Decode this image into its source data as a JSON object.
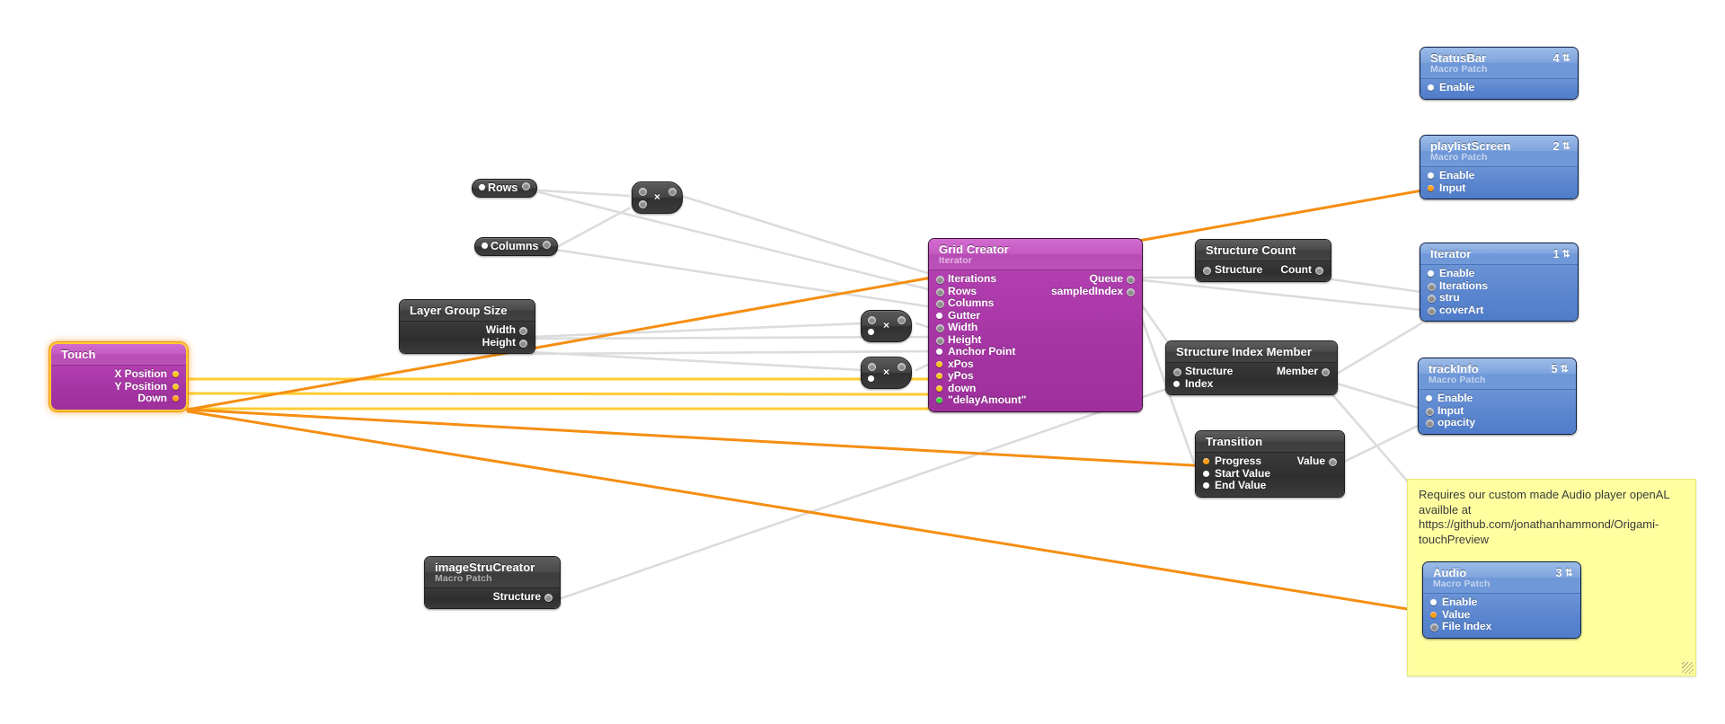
{
  "app": {
    "title": "Origami / Quartz Composer patch editor",
    "canvas_background": "#ffffff",
    "accent_orange": "#f58e11",
    "accent_yellow": "#ffcc33",
    "wire_gray": "#dcdcdc"
  },
  "patches": [
    {
      "id": "statusbar",
      "name": "StatusBar",
      "subtitle": "Macro Patch",
      "index": "4",
      "theme": "blue",
      "inputs": [
        {
          "label": "Enable",
          "port": "white"
        }
      ],
      "outputs": []
    },
    {
      "id": "playlistscreen",
      "name": "playlistScreen",
      "subtitle": "Macro Patch",
      "index": "2",
      "theme": "blue",
      "inputs": [
        {
          "label": "Enable",
          "port": "white"
        },
        {
          "label": "Input",
          "port": "orange"
        }
      ],
      "outputs": []
    },
    {
      "id": "iterator",
      "name": "Iterator",
      "subtitle": "",
      "index": "1",
      "theme": "blue",
      "inputs": [
        {
          "label": "Enable",
          "port": "white"
        },
        {
          "label": "Iterations",
          "port": "gray"
        },
        {
          "label": "stru",
          "port": "gray"
        },
        {
          "label": "coverArt",
          "port": "gray"
        }
      ],
      "outputs": []
    },
    {
      "id": "trackinfo",
      "name": "trackInfo",
      "subtitle": "Macro Patch",
      "index": "5",
      "theme": "blue",
      "inputs": [
        {
          "label": "Enable",
          "port": "white"
        },
        {
          "label": "Input",
          "port": "gray"
        },
        {
          "label": "opacity",
          "port": "gray"
        }
      ],
      "outputs": []
    },
    {
      "id": "audio",
      "name": "Audio",
      "subtitle": "Macro Patch",
      "index": "3",
      "theme": "blue",
      "inputs": [
        {
          "label": "Enable",
          "port": "white"
        },
        {
          "label": "Value",
          "port": "orange"
        },
        {
          "label": "File Index",
          "port": "gray"
        }
      ],
      "outputs": []
    },
    {
      "id": "gridcreator",
      "name": "Grid Creator",
      "subtitle": "Iterator",
      "index": "",
      "theme": "purple",
      "inputs": [
        {
          "label": "Iterations",
          "port": "gray"
        },
        {
          "label": "Rows",
          "port": "gray"
        },
        {
          "label": "Columns",
          "port": "gray"
        },
        {
          "label": "Gutter",
          "port": "white"
        },
        {
          "label": "Width",
          "port": "gray"
        },
        {
          "label": "Height",
          "port": "gray"
        },
        {
          "label": "Anchor Point",
          "port": "white"
        },
        {
          "label": "xPos",
          "port": "yellow"
        },
        {
          "label": "yPos",
          "port": "yellow"
        },
        {
          "label": "down",
          "port": "yellow"
        },
        {
          "label": "\"delayAmount\"",
          "port": "green"
        }
      ],
      "outputs": [
        {
          "label": "Queue",
          "port": "gray"
        },
        {
          "label": "sampledIndex",
          "port": "gray"
        }
      ]
    },
    {
      "id": "touch",
      "name": "Touch",
      "subtitle": "",
      "index": "",
      "theme": "purple",
      "selected": true,
      "inputs": [],
      "outputs": [
        {
          "label": "X Position",
          "port": "yellow"
        },
        {
          "label": "Y Position",
          "port": "yellow"
        },
        {
          "label": "Down",
          "port": "orange"
        }
      ]
    },
    {
      "id": "layergroupsize",
      "name": "Layer Group Size",
      "subtitle": "",
      "index": "",
      "theme": "gray",
      "inputs": [],
      "outputs": [
        {
          "label": "Width",
          "port": "gray"
        },
        {
          "label": "Height",
          "port": "gray"
        }
      ]
    },
    {
      "id": "structurecount",
      "name": "Structure Count",
      "subtitle": "",
      "index": "",
      "theme": "gray",
      "pairs": [
        {
          "in": {
            "label": "Structure",
            "port": "gray"
          },
          "out": {
            "label": "Count",
            "port": "gray"
          }
        }
      ]
    },
    {
      "id": "structureindexmember",
      "name": "Structure Index Member",
      "subtitle": "",
      "index": "",
      "theme": "gray",
      "pairs": [
        {
          "in": {
            "label": "Structure",
            "port": "gray"
          },
          "out": {
            "label": "Member",
            "port": "gray"
          }
        }
      ],
      "inputs": [
        {
          "label": "Index",
          "port": "white"
        }
      ]
    },
    {
      "id": "transition",
      "name": "Transition",
      "subtitle": "",
      "index": "",
      "theme": "gray",
      "pairs": [
        {
          "in": {
            "label": "Progress",
            "port": "orange"
          },
          "out": {
            "label": "Value",
            "port": "gray"
          }
        }
      ],
      "inputs": [
        {
          "label": "Start Value",
          "port": "white"
        },
        {
          "label": "End Value",
          "port": "white"
        }
      ]
    },
    {
      "id": "imagestrucreator",
      "name": "imageStruCreator",
      "subtitle": "Macro Patch",
      "index": "",
      "theme": "gray",
      "inputs": [],
      "outputs": [
        {
          "label": "Structure",
          "port": "gray"
        }
      ]
    }
  ],
  "pills": [
    {
      "id": "rows",
      "label": "Rows"
    },
    {
      "id": "columns",
      "label": "Columns"
    }
  ],
  "multipliers": [
    {
      "id": "mult-top",
      "symbol": "×"
    },
    {
      "id": "mult-mid",
      "symbol": "×"
    },
    {
      "id": "mult-low",
      "symbol": "×"
    }
  ],
  "note": {
    "text": "Requires our custom made Audio player openAL availble at https://github.com/jonathanhammond/Origami-touchPreview"
  }
}
